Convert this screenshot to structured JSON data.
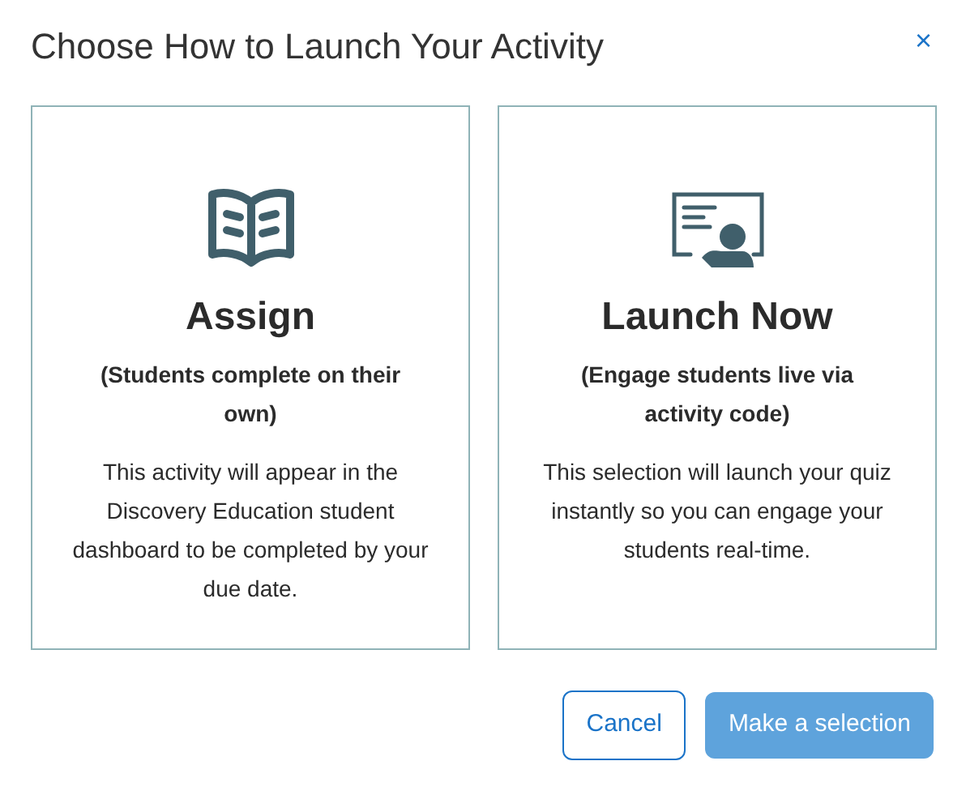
{
  "dialog": {
    "title": "Choose How to Launch Your Activity",
    "close": "×"
  },
  "options": [
    {
      "kind": "book",
      "title": "Assign",
      "subtitle": "(Students complete on their own)",
      "description": "This activity will appear in the Discovery Education student dashboard to be completed by your due date.",
      "selected": false
    },
    {
      "kind": "presentation",
      "title": "Launch Now",
      "subtitle": "(Engage students live via activity code)",
      "description": "This selection will launch your quiz instantly so you can engage your students real-time.",
      "selected": false
    }
  ],
  "buttons": {
    "cancel": "Cancel",
    "confirm": {
      "label": "Make a selection",
      "disabled": true
    }
  }
}
